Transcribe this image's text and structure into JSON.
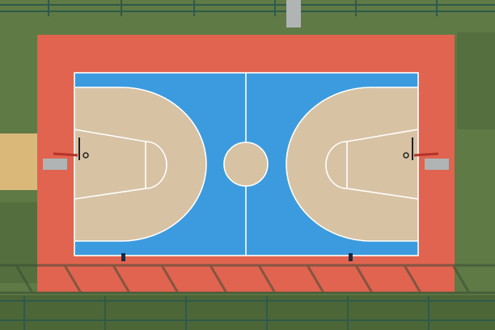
{
  "scene": {
    "subject": "basketball-court-aerial",
    "colors": {
      "grass": "#5f7a45",
      "grass_dark": "#4c6638",
      "surround": "#e0644f",
      "court": "#3c9bde",
      "key_area": "#d7c2a4",
      "lines": "#ffffff",
      "fence": "#2f5a4a",
      "shadow": "#3a4a35",
      "pole": "#b0b4b4",
      "hoop": "#b5332b"
    }
  }
}
